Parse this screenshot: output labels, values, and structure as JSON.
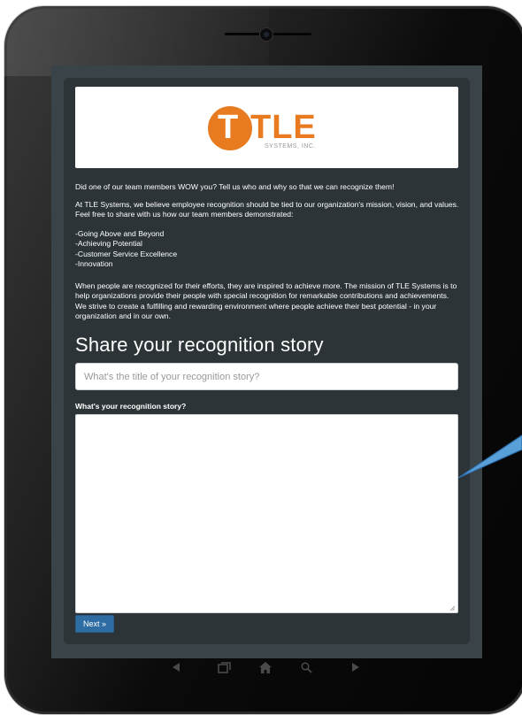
{
  "logo": {
    "mark": "T",
    "name": "TLE",
    "subtitle": "SYSTEMS, INC.",
    "color": "#e87a20"
  },
  "intro": {
    "line1": "Did one of our team members WOW you?  Tell us who and why so that we can recognize them!",
    "line2": "At TLE Systems, we believe employee recognition should be tied to our organization's mission, vision, and values.  Feel free to share with us how our team members demonstrated:",
    "list": [
      "-Going Above and Beyond",
      "-Achieving Potential",
      "-Customer Service Excellence",
      "-Innovation"
    ],
    "line3": "When people are recognized for their efforts, they are inspired to achieve more. The mission of TLE Systems is to help organizations provide their people with special recognition for remarkable contributions and achievements. We strive to create a fulfilling and rewarding environment where people achieve their best potential - in your organization and in our own."
  },
  "form": {
    "heading": "Share your recognition story",
    "title_placeholder": "What's the title of your recognition story?",
    "title_value": "",
    "story_label": "What's your recognition story?",
    "story_value": "",
    "next_label": "Next »",
    "next_color": "#2e6da4"
  },
  "device_nav": {
    "icons": [
      "back-icon",
      "recent-apps-icon",
      "home-icon",
      "search-icon",
      "forward-icon"
    ]
  }
}
